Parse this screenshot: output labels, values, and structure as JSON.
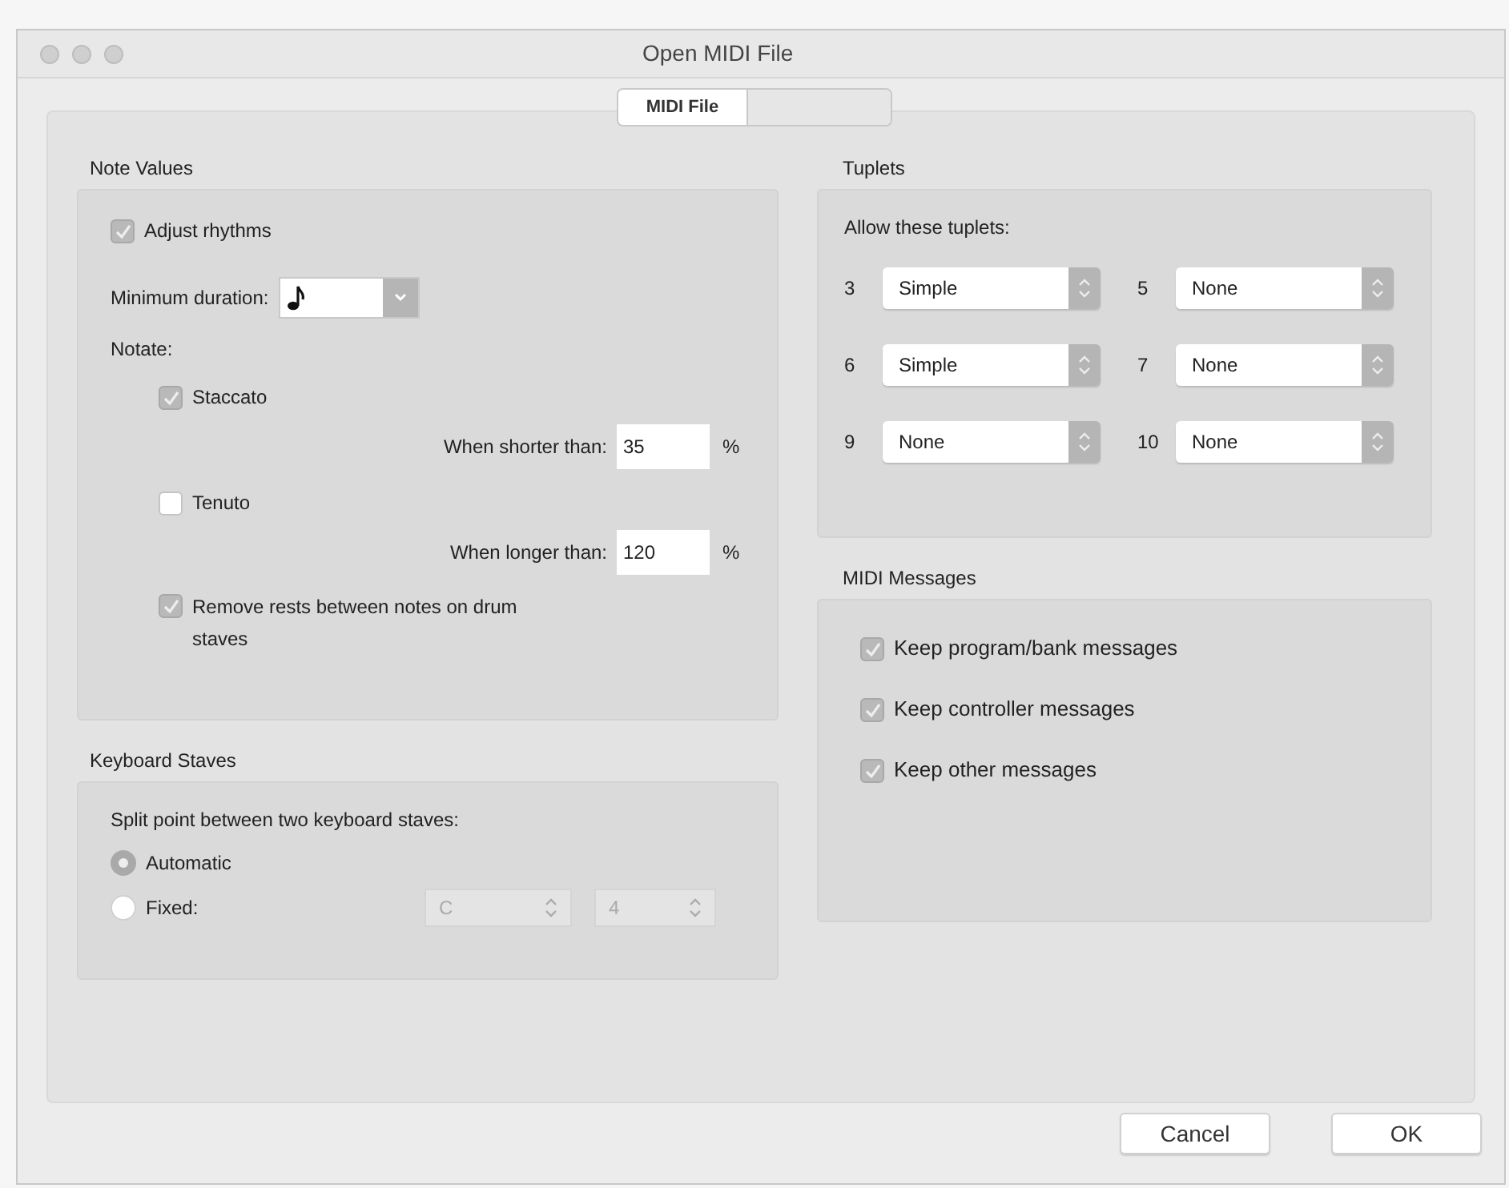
{
  "window": {
    "title": "Open MIDI File"
  },
  "tabs": [
    {
      "label": "MIDI File",
      "selected": true
    },
    {
      "selected": false
    }
  ],
  "note_values": {
    "title": "Note Values",
    "adjust_rhythms": {
      "label": "Adjust rhythms",
      "checked": true
    },
    "minimum_duration": {
      "label": "Minimum duration:"
    },
    "notate_label": "Notate:",
    "articulations": [
      {
        "label": "Staccato",
        "checked": true,
        "threshold_label": "When shorter than:",
        "value": "35",
        "unit": "%"
      },
      {
        "label": "Tenuto",
        "checked": false,
        "threshold_label": "When longer than:",
        "value": "120",
        "unit": "%"
      }
    ],
    "remove_rests": {
      "label": "Remove rests between notes on drum staves",
      "checked": true
    }
  },
  "keyboard_staves": {
    "title": "Keyboard Staves",
    "prompt": "Split point between two keyboard staves:",
    "options": [
      {
        "label": "Automatic",
        "selected": true
      },
      {
        "label": "Fixed:",
        "selected": false
      }
    ],
    "fields": [
      {
        "value": "C",
        "disabled": true
      },
      {
        "value": "4",
        "disabled": true
      }
    ]
  },
  "tuplets": {
    "title": "Tuplets",
    "prompt": "Allow these tuplets:",
    "items": [
      {
        "number": "3",
        "value": "Simple"
      },
      {
        "number": "5",
        "value": "None"
      },
      {
        "number": "6",
        "value": "Simple"
      },
      {
        "number": "7",
        "value": "None"
      },
      {
        "number": "9",
        "value": "None"
      },
      {
        "number": "10",
        "value": "None"
      }
    ]
  },
  "midi_messages": {
    "title": "MIDI Messages",
    "options": [
      {
        "label": "Keep program/bank messages",
        "checked": true
      },
      {
        "label": "Keep controller messages",
        "checked": true
      },
      {
        "label": "Keep other messages",
        "checked": true
      }
    ]
  },
  "buttons": [
    {
      "label": "Cancel"
    },
    {
      "label": "OK"
    }
  ]
}
